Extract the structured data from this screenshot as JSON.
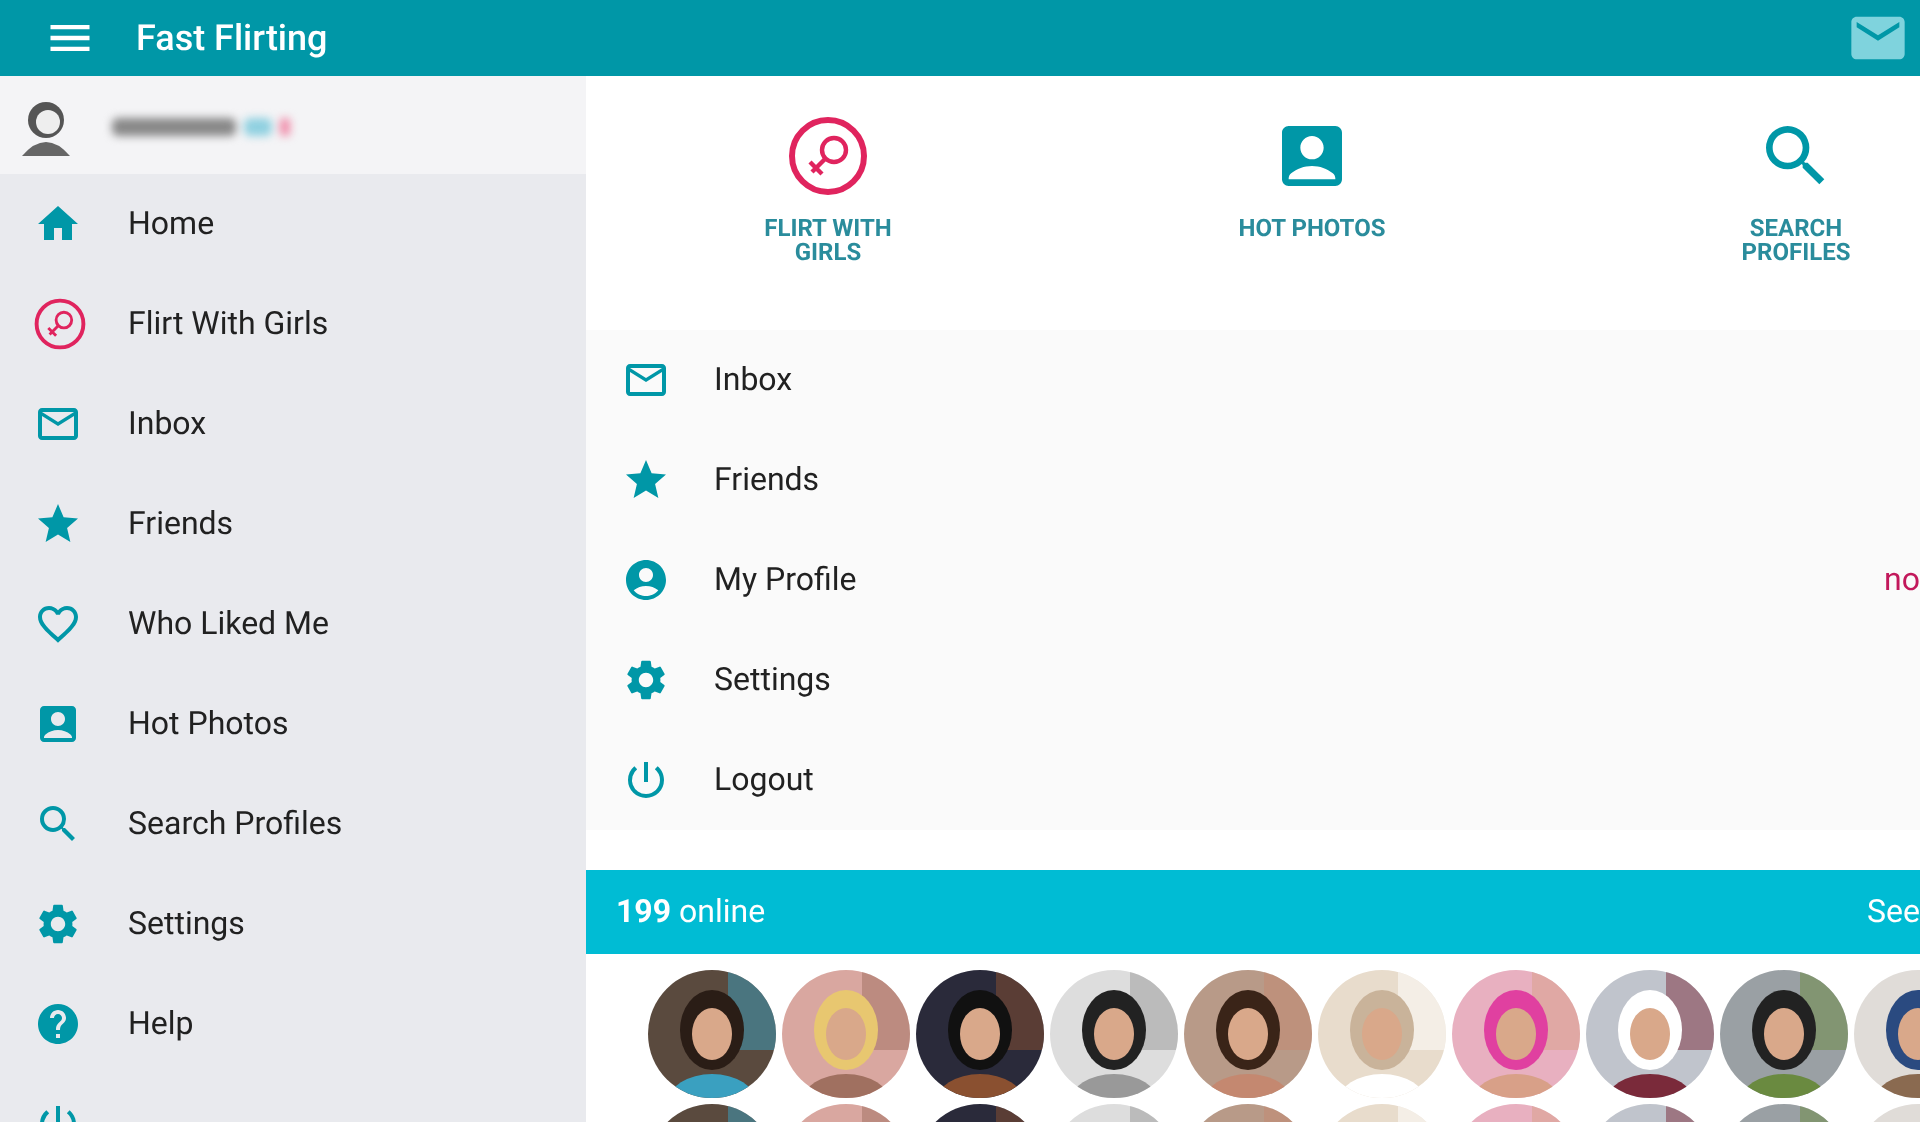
{
  "header": {
    "title": "Fast Flirting"
  },
  "sidebar": {
    "items": [
      {
        "label": "Home"
      },
      {
        "label": "Flirt With Girls"
      },
      {
        "label": "Inbox"
      },
      {
        "label": "Friends"
      },
      {
        "label": "Who Liked Me"
      },
      {
        "label": "Hot Photos"
      },
      {
        "label": "Search Profiles"
      },
      {
        "label": "Settings"
      },
      {
        "label": "Help"
      }
    ]
  },
  "quick_actions": [
    {
      "label": "FLIRT WITH GIRLS"
    },
    {
      "label": "HOT PHOTOS"
    },
    {
      "label": "SEARCH PROFILES"
    }
  ],
  "menu": [
    {
      "label": "Inbox"
    },
    {
      "label": "Friends"
    },
    {
      "label": "My Profile",
      "note": "no"
    },
    {
      "label": "Settings"
    },
    {
      "label": "Logout"
    }
  ],
  "online_bar": {
    "count": "**199** online",
    "link": "See"
  }
}
